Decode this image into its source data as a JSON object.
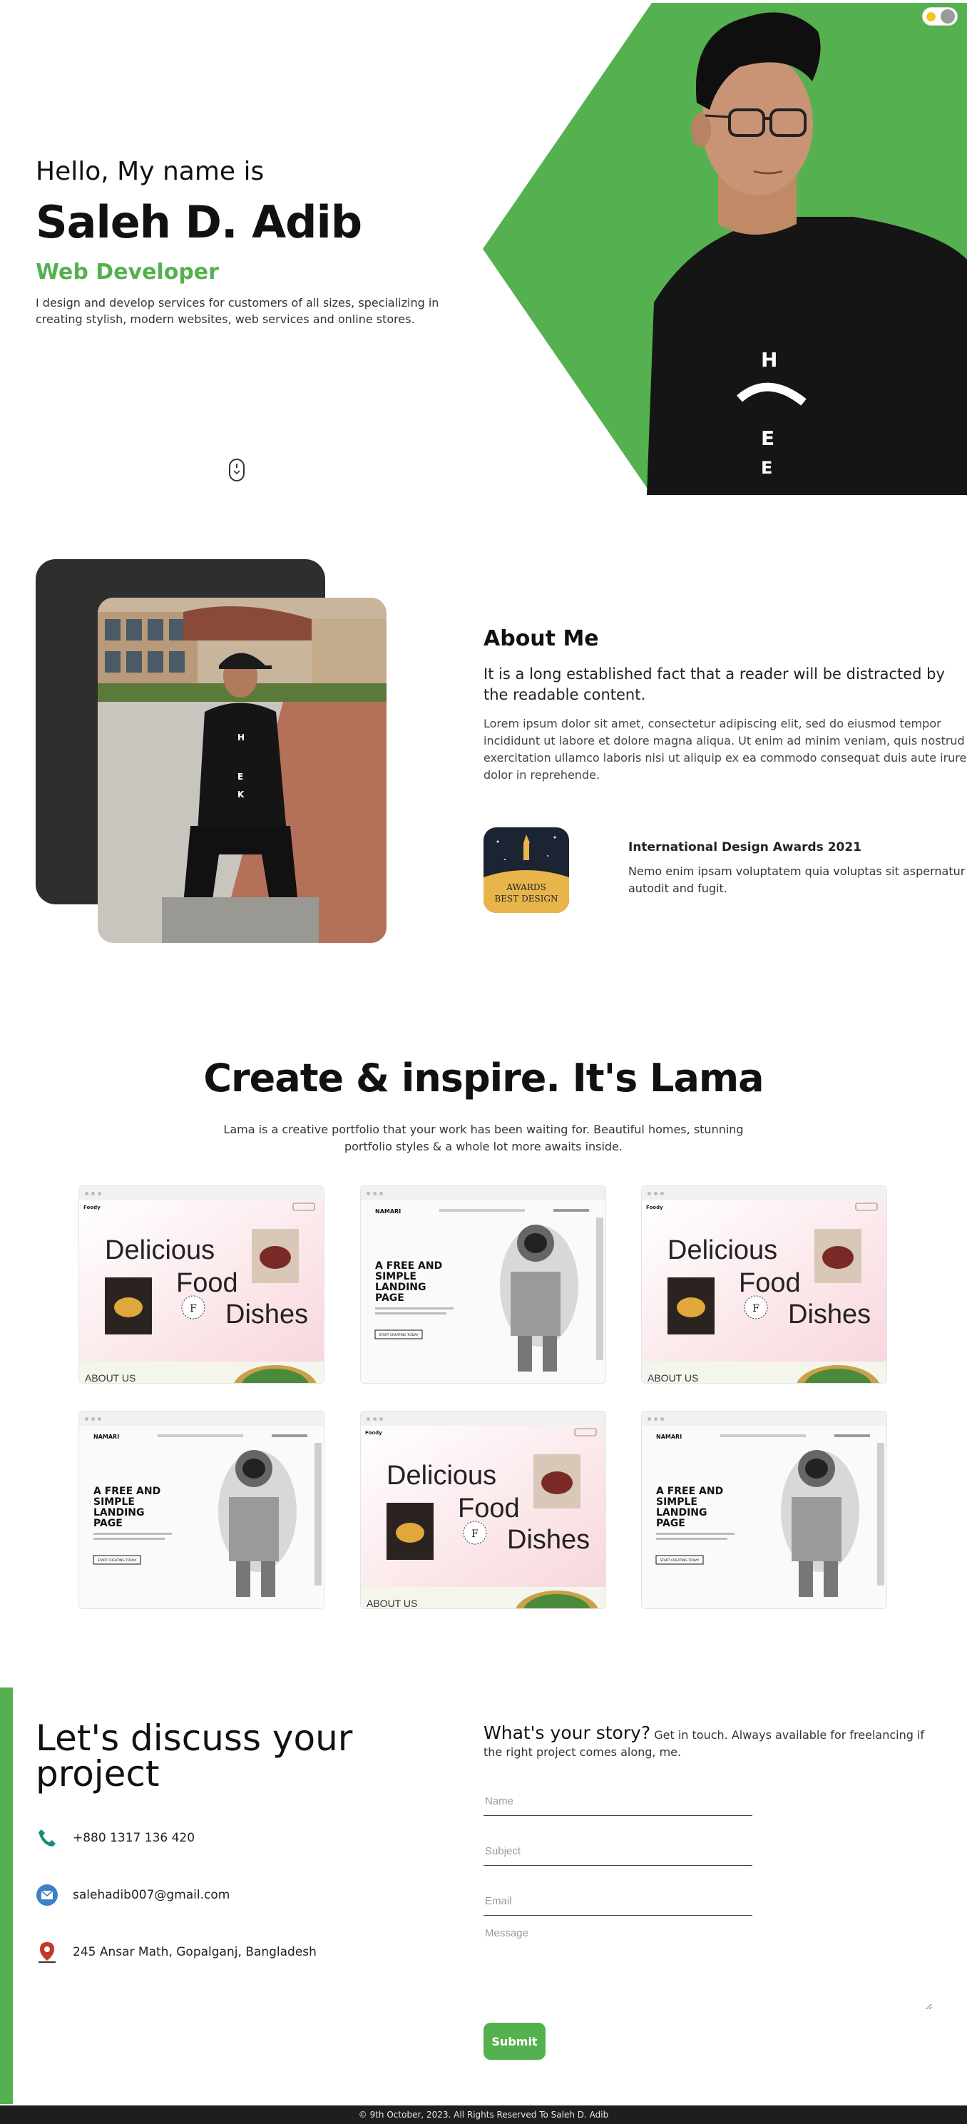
{
  "colors": {
    "accent": "#55b14f",
    "dark_panel": "#2e2e2e",
    "footer_bg": "#1e1e1e"
  },
  "hero": {
    "greeting": "Hello, My name is",
    "name": "Saleh D. Adib",
    "role": "Web Developer",
    "description": "I design and develop services for customers of all sizes, specializing in creating stylish, modern websites, web services and online stores.",
    "photo_shirt_letters": [
      "H",
      "E",
      "E"
    ]
  },
  "icons": {
    "theme_toggle": "theme-toggle-icon",
    "scroll": "mouse-scroll-icon",
    "phone": "phone-icon",
    "email": "email-icon",
    "address": "location-pin-icon"
  },
  "about": {
    "title": "About Me",
    "lead": "It is a long established fact that a reader will be distracted by the readable content.",
    "body": "Lorem ipsum dolor sit amet, consectetur adipiscing elit, sed do eiusmod tempor incididunt ut labore et dolore magna aliqua. Ut enim ad minim veniam, quis nostrud exercitation ullamco laboris nisi ut aliquip ex ea commodo consequat duis aute irure dolor in reprehende.",
    "award": {
      "badge_line1": "AWARDS",
      "badge_line2": "BEST DESIGN",
      "title": "International Design Awards 2021",
      "description": "Nemo enim ipsam voluptatem quia voluptas sit aspernatur autodit and fugit."
    }
  },
  "portfolio": {
    "title": "Create & inspire. It's Lama",
    "subtitle": "Lama is a creative portfolio that your work has been waiting for. Beautiful homes, stunning portfolio styles & a whole lot more awaits inside.",
    "food_card": {
      "brand": "Foody",
      "word1": "Delicious",
      "word2": "Food",
      "word3": "Dishes",
      "badge": "F",
      "footer_text": "ABOUT US"
    },
    "landing_card": {
      "brand": "NAMARI",
      "heading": [
        "A FREE AND",
        "SIMPLE",
        "LANDING",
        "PAGE"
      ],
      "button": "START CREATING TODAY"
    },
    "cards": [
      "food",
      "landing",
      "food",
      "landing",
      "food",
      "landing"
    ]
  },
  "contact": {
    "title": "Let's discuss your project",
    "phone": "+880 1317 136 420",
    "email": "salehadib007@gmail.com",
    "address": "245 Ansar Math, Gopalganj, Bangladesh",
    "story_head": "What's your story?",
    "story_text": " Get in touch. Always available for freelancing if the right project comes along, me.",
    "form": {
      "name_placeholder": "Name",
      "subject_placeholder": "Subject",
      "email_placeholder": "Email",
      "message_placeholder": "Message",
      "submit_label": "Submit"
    }
  },
  "footer": {
    "text": "© 9th October, 2023. All Rights Reserved To Saleh D. Adib"
  }
}
